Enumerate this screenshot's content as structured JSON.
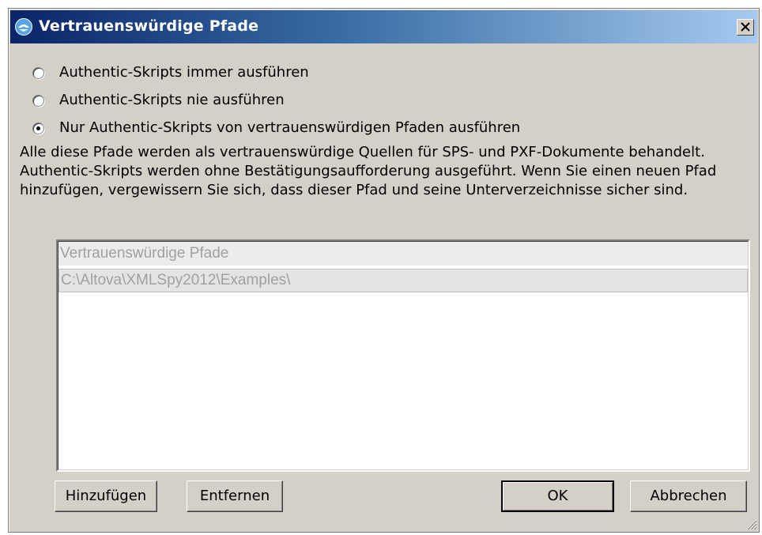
{
  "dialog": {
    "title": "Vertrauenswürdige Pfade",
    "close_label": "✕"
  },
  "options": [
    {
      "label": "Authentic-Skripts immer ausführen",
      "selected": false
    },
    {
      "label": "Authentic-Skripts nie ausführen",
      "selected": false
    },
    {
      "label": "Nur Authentic-Skripts von vertrauenswürdigen Pfaden ausführen",
      "selected": true
    }
  ],
  "description": "Alle diese Pfade werden als vertrauenswürdige Quellen für SPS- und PXF-Dokumente behandelt. Authentic-Skripts werden ohne Bestätigungsaufforderung ausgeführt. Wenn Sie einen neuen Pfad hinzufügen, vergewissern Sie sich, dass dieser Pfad und seine Unterverzeichnisse sicher sind.",
  "paths_list": {
    "header": "Vertrauenswürdige Pfade",
    "rows": [
      "C:\\Altova\\XMLSpy2012\\Examples\\"
    ]
  },
  "buttons": {
    "add": "Hinzufügen",
    "remove": "Entfernen",
    "ok": "OK",
    "cancel": "Abbrechen"
  }
}
